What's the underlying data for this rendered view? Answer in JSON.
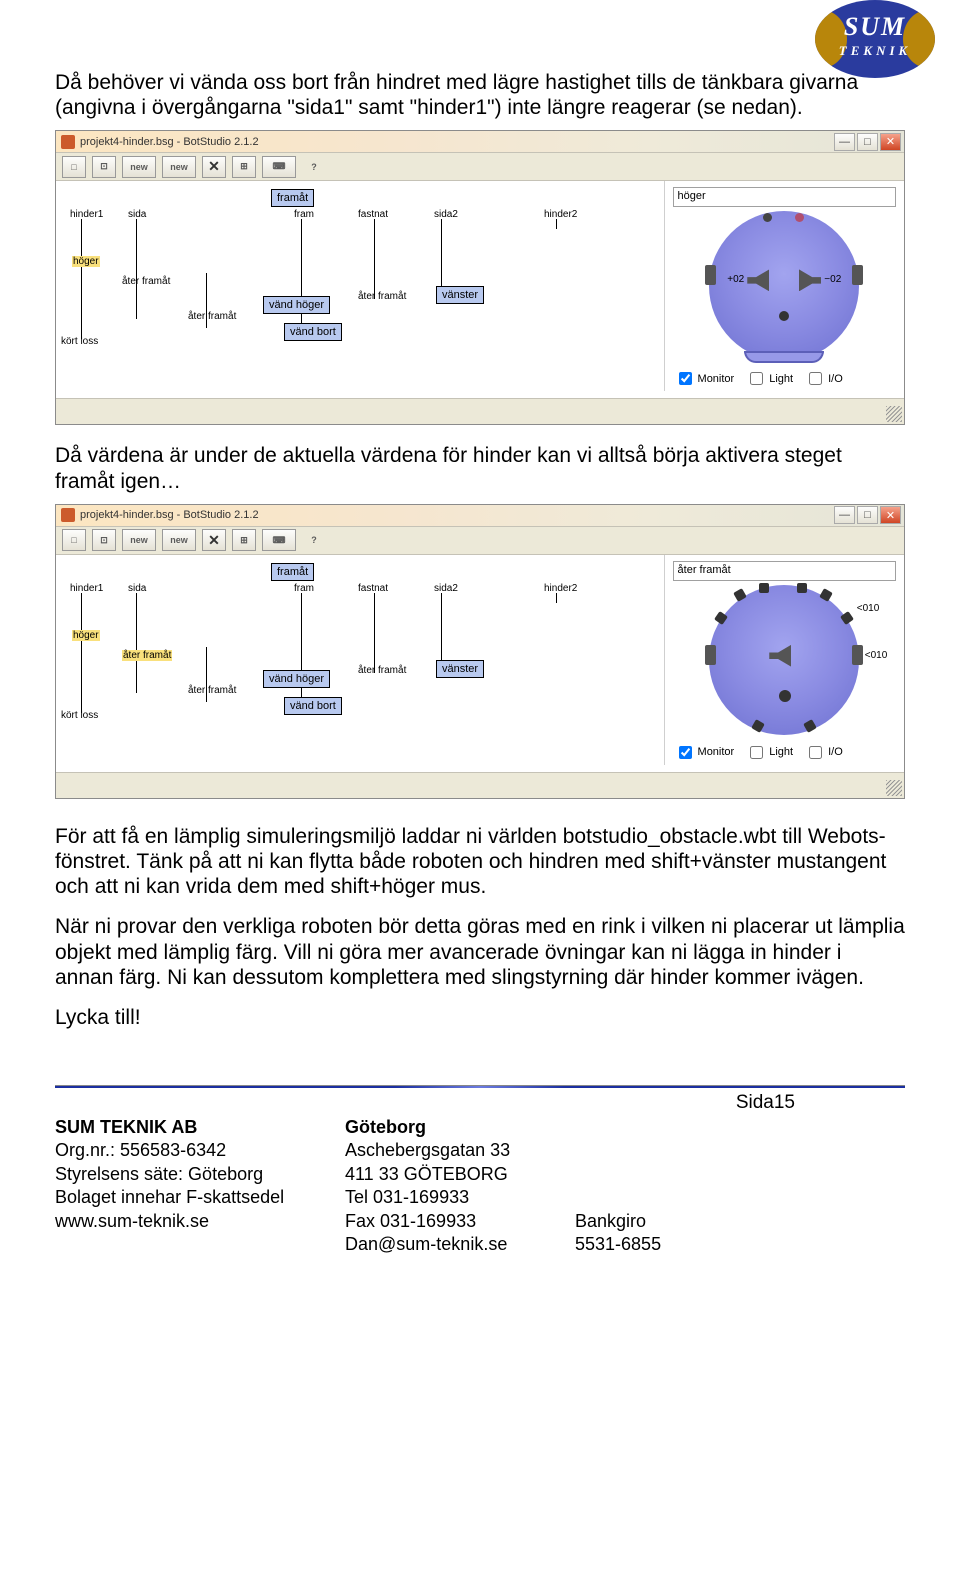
{
  "logo": {
    "line1": "SUM",
    "line2": "TEKNIK"
  },
  "para1": "Då behöver vi vända oss bort från hindret med lägre hastighet tills de tänkbara givarna (angivna i övergångarna \"sida1\" samt \"hinder1\") inte längre reagerar (se nedan).",
  "para2": "Då värdena är under de aktuella värdena för hinder kan vi alltså börja aktivera steget framåt igen…",
  "para3": "För att få en lämplig simuleringsmiljö laddar ni världen botstudio_obstacle.wbt till Webots-fönstret. Tänk på att ni kan flytta både roboten och hindren med shift+vänster mustangent och att ni kan vrida dem med shift+höger mus.",
  "para4": "När ni provar den verkliga roboten bör detta göras med en rink i vilken ni placerar ut lämplia objekt med lämplig färg. Vill ni göra mer avancerade övningar kan ni lägga in hinder i annan färg. Ni kan dessutom komplettera med slingstyrning där hinder kommer ivägen.",
  "para5": "Lycka till!",
  "bot1": {
    "title": "projekt4-hinder.bsg - BotStudio 2.1.2",
    "toolbar": [
      "□",
      "⊡",
      "new",
      "new",
      "✕",
      "⊞",
      "⌨",
      "?"
    ],
    "top_input": "höger",
    "states": {
      "framat": "framåt",
      "vand_hoger": "vänd höger",
      "vand_bort": "vänd bort",
      "vanster": "vänster"
    },
    "transitions": {
      "hinder1": "hinder1",
      "sida": "sida",
      "fram": "fram",
      "fastnat": "fastnat",
      "sida2": "sida2",
      "hinder2": "hinder2",
      "hoger": "höger",
      "ater_framat_1": "åter framåt",
      "ater_framat_2": "åter framåt",
      "ater_framat_3": "åter framåt",
      "kort_loss": "kört loss"
    },
    "robot_left": "+02",
    "robot_right": "−02",
    "checks": {
      "monitor": "Monitor",
      "light": "Light",
      "io": "I/O"
    }
  },
  "bot2": {
    "title": "projekt4-hinder.bsg - BotStudio 2.1.2",
    "toolbar": [
      "□",
      "⊡",
      "new",
      "new",
      "✕",
      "⊞",
      "⌨",
      "?"
    ],
    "top_input": "åter framåt",
    "states": {
      "framat": "framåt",
      "vand_hoger": "vänd höger",
      "vand_bort": "vänd bort",
      "vanster": "vänster"
    },
    "transitions": {
      "hinder1": "hinder1",
      "sida": "sida",
      "fram": "fram",
      "fastnat": "fastnat",
      "sida2": "sida2",
      "hinder2": "hinder2",
      "hoger": "höger",
      "ater_framat_1": "åter framåt",
      "ater_framat_2": "åter framåt",
      "ater_framat_3": "åter framåt",
      "kort_loss": "kört loss"
    },
    "robot_top": "<010",
    "robot_right": "<010",
    "checks": {
      "monitor": "Monitor",
      "light": "Light",
      "io": "I/O"
    }
  },
  "footer": {
    "page": "Sida15",
    "company": "SUM TEKNIK AB",
    "orgnr": "Org.nr.: 556583-6342",
    "sate": "Styrelsens säte: Göteborg",
    "fskatt": "Bolaget innehar F-skattsedel",
    "web": "www.sum-teknik.se",
    "city": "Göteborg",
    "addr1": "Aschebergsgatan 33",
    "addr2": "411 33 GÖTEBORG",
    "tel": "Tel 031-169933",
    "fax": "Fax 031-169933",
    "email": "Dan@sum-teknik.se",
    "bankgiro_h": "Bankgiro",
    "bankgiro_v": "5531-6855"
  }
}
